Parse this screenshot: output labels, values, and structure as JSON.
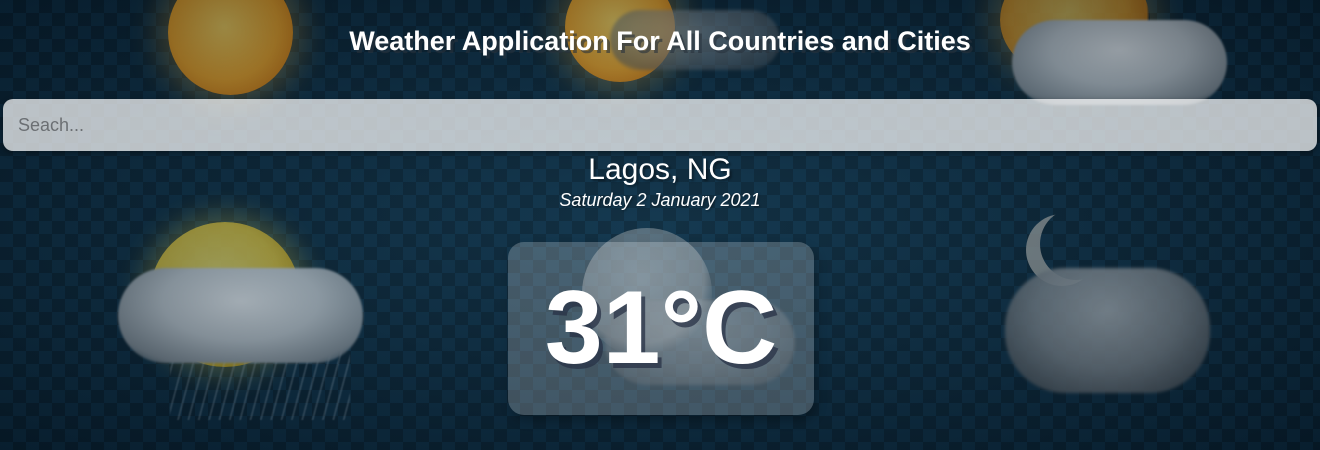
{
  "header": {
    "title": "Weather Application For All Countries and Cities"
  },
  "search": {
    "placeholder": "Seach...",
    "value": ""
  },
  "location": {
    "name": "Lagos, NG",
    "date": "Saturday 2 January 2021"
  },
  "weather": {
    "temperature": "31°C"
  },
  "background": {
    "base_color": "#0f2f44",
    "icons": [
      "sun-icon",
      "sun-cloud-icon",
      "partly-cloudy-icon",
      "sun-cloud-rain-icon",
      "cloud-sun-icon",
      "moon-cloud-icon"
    ]
  }
}
